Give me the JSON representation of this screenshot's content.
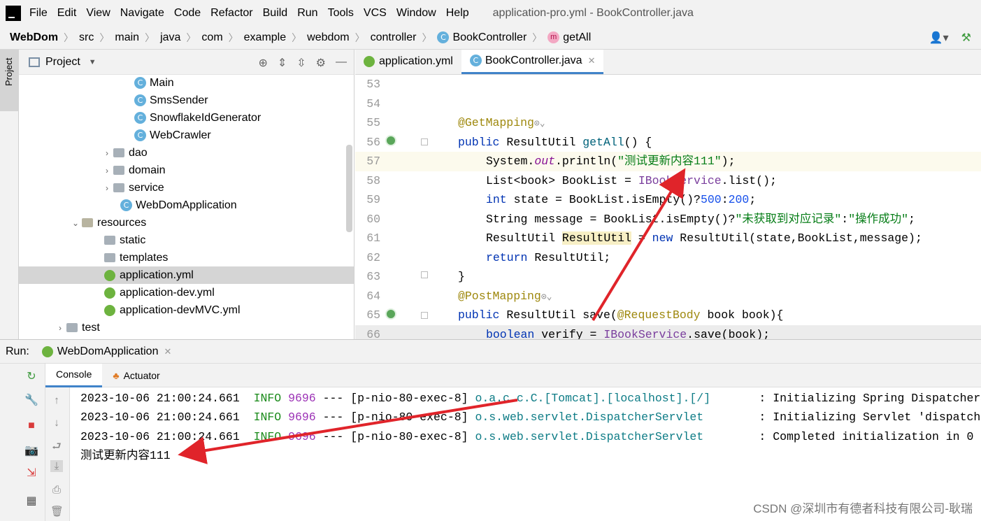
{
  "menu": {
    "items": [
      "File",
      "Edit",
      "View",
      "Navigate",
      "Code",
      "Refactor",
      "Build",
      "Run",
      "Tools",
      "VCS",
      "Window",
      "Help"
    ],
    "title": "application-pro.yml - BookController.java"
  },
  "breadcrumb": {
    "items": [
      "WebDom",
      "src",
      "main",
      "java",
      "com",
      "example",
      "webdom",
      "controller",
      "BookController",
      "getAll"
    ]
  },
  "sidebar_tab": "Project",
  "project": {
    "title": "Project",
    "tree": [
      {
        "label": "Main",
        "type": "class"
      },
      {
        "label": "SmsSender",
        "type": "class"
      },
      {
        "label": "SnowflakeIdGenerator",
        "type": "class"
      },
      {
        "label": "WebCrawler",
        "type": "class"
      },
      {
        "label": "dao",
        "type": "folder"
      },
      {
        "label": "domain",
        "type": "folder"
      },
      {
        "label": "service",
        "type": "folder"
      },
      {
        "label": "WebDomApplication",
        "type": "class"
      },
      {
        "label": "resources",
        "type": "folder"
      },
      {
        "label": "static",
        "type": "folder"
      },
      {
        "label": "templates",
        "type": "folder"
      },
      {
        "label": "application.yml",
        "type": "yml"
      },
      {
        "label": "application-dev.yml",
        "type": "yml"
      },
      {
        "label": "application-devMVC.yml",
        "type": "yml"
      },
      {
        "label": "test",
        "type": "folder"
      }
    ]
  },
  "editor": {
    "tabs": [
      "application.yml",
      "BookController.java"
    ],
    "line_numbers": [
      "53",
      "54",
      "55",
      "56",
      "57",
      "58",
      "59",
      "60",
      "61",
      "62",
      "63",
      "64",
      "65",
      "66"
    ],
    "code": {
      "l55": "@GetMapping",
      "l56_a": "public",
      "l56_b": " ResultUtil ",
      "l56_c": "getAll",
      "l56_d": "() {",
      "l57_a": "System.",
      "l57_b": "out",
      "l57_c": ".println(",
      "l57_d": "\"测试更新内容111\"",
      "l57_e": ");",
      "l58_a": "List<book> BookList = ",
      "l58_b": "IBookService",
      "l58_c": ".list();",
      "l59_a": "int",
      "l59_b": " state = BookList.isEmpty()?",
      "l59_c": "500",
      "l59_d": ":",
      "l59_e": "200",
      "l59_f": ";",
      "l60_a": "String message = BookList.isEmpty()?",
      "l60_b": "\"未获取到对应记录\"",
      "l60_c": ":",
      "l60_d": "\"操作成功\"",
      "l60_e": ";",
      "l61_a": "ResultUtil ",
      "l61_b": "ResultUtil",
      "l61_c": " = ",
      "l61_d": "new",
      "l61_e": " ResultUtil(state,BookList,message);",
      "l62_a": "return",
      "l62_b": " ResultUtil;",
      "l63": "}",
      "l64": "@PostMapping",
      "l65_a": "public",
      "l65_b": " ResultUtil save(",
      "l65_c": "@RequestBody",
      "l65_d": " book book){",
      "l66_a": "boolean",
      "l66_b": " verify = ",
      "l66_c": "IBookService",
      "l66_d": ".save(book);"
    }
  },
  "run": {
    "label": "Run:",
    "config": "WebDomApplication",
    "tabs": [
      "Console",
      "Actuator"
    ],
    "console": [
      {
        "ts": "2023-10-06 21:00:24.661",
        "level": "INFO",
        "pid": "9696",
        "thread": " --- [p-nio-80-exec-8] ",
        "logger": "o.a.c.c.C.[Tomcat].[localhost].[/]      ",
        "msg": " : Initializing Spring DispatcherServlet"
      },
      {
        "ts": "2023-10-06 21:00:24.661",
        "level": "INFO",
        "pid": "9696",
        "thread": " --- [p-nio-80-exec-8] ",
        "logger": "o.s.web.servlet.DispatcherServlet       ",
        "msg": " : Initializing Servlet 'dispatcherServlet'"
      },
      {
        "ts": "2023-10-06 21:00:24.661",
        "level": "INFO",
        "pid": "9696",
        "thread": " --- [p-nio-80-exec-8] ",
        "logger": "o.s.web.servlet.DispatcherServlet       ",
        "msg": " : Completed initialization in 0"
      }
    ],
    "output": "测试更新内容111"
  },
  "watermark": "CSDN @深圳市有德者科技有限公司-耿瑞",
  "colors": {
    "arrow": "#e0242a",
    "accent": "#4083c9"
  }
}
